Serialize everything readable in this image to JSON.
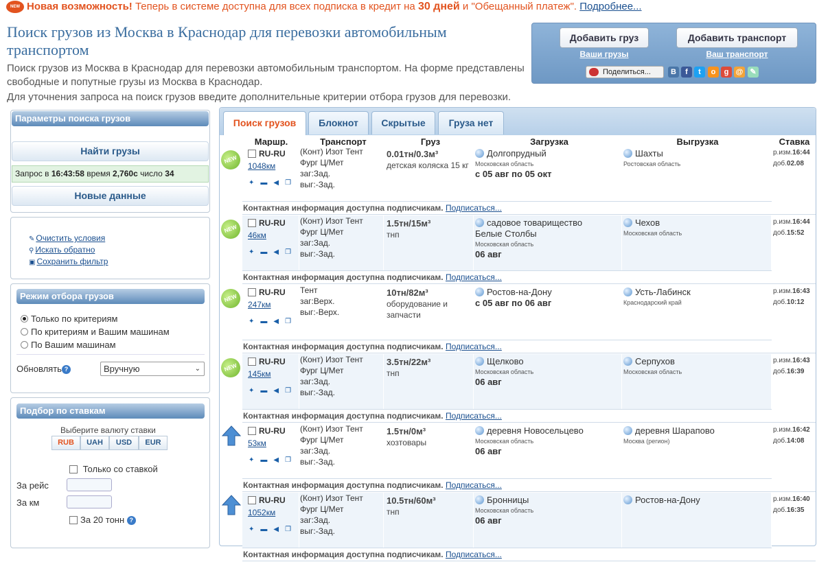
{
  "banner": {
    "badge": "NEW",
    "title": "Новая возможность!",
    "text1": "Теперь в системе доступна для всех подписка в кредит на",
    "days": "30 дней",
    "text2": "и \"Обещанный платеж\".",
    "more": "Подробнее..."
  },
  "page": {
    "title": "Поиск грузов из Москва в Краснодар для перевозки автомобильным транспортом",
    "desc": "Поиск грузов из Москва в Краснодар для перевозки автомобильным транспортом. На форме представлены свободные и попутные грузы из Москва в Краснодар.",
    "desc2": "Для уточнения запроса на поиск грузов введите дополнительные критерии отбора грузов для перевозки."
  },
  "actions": {
    "add_cargo": "Добавить груз",
    "add_transport": "Добавить транспорт",
    "my_cargo": "Ваши грузы",
    "my_transport": "Ваш транспорт",
    "share": "Поделиться..."
  },
  "social": [
    {
      "icon": "vk-icon",
      "t": "B",
      "c": "#4a76a8"
    },
    {
      "icon": "facebook-icon",
      "t": "f",
      "c": "#3b5998"
    },
    {
      "icon": "twitter-icon",
      "t": "t",
      "c": "#1da1f2"
    },
    {
      "icon": "odnoklassniki-icon",
      "t": "o",
      "c": "#f7931e"
    },
    {
      "icon": "googleplus-icon",
      "t": "g",
      "c": "#dd4b39"
    },
    {
      "icon": "mailru-icon",
      "t": "@",
      "c": "#f2a43a"
    },
    {
      "icon": "livejournal-icon",
      "t": "✎",
      "c": "#9db"
    }
  ],
  "sidebar": {
    "params_title": "Параметры поиска грузов",
    "find": "Найти грузы",
    "query": {
      "label": "Запрос в",
      "time": "16:43:58",
      "time_label": "время",
      "duration": "2,760с",
      "count_label": "число",
      "count": "34"
    },
    "new_data": "Новые данные",
    "clear": "Очистить условия",
    "reverse": "Искать обратно",
    "save": "Сохранить фильтр",
    "mode_title": "Режим отбора грузов",
    "modes": [
      "Только по критериям",
      "По критериям и Вашим машинам",
      "По Вашим машинам"
    ],
    "refresh_label": "Обновлять",
    "refresh_value": "Вручную",
    "rates_title": "Подбор по ставкам",
    "currency_label": "Выберите валюту ставки",
    "currencies": [
      "RUB",
      "UAH",
      "USD",
      "EUR"
    ],
    "only_rate": "Только со ставкой",
    "per_trip": "За рейс",
    "per_km": "За км",
    "per_20t": "За 20 тонн"
  },
  "tabs": [
    "Поиск грузов",
    "Блокнот",
    "Скрытые",
    "Груза нет"
  ],
  "columns": {
    "route": "Маршр.",
    "transport": "Транспорт",
    "cargo": "Груз",
    "loading": "Загрузка",
    "unloading": "Выгрузка",
    "rate": "Ставка"
  },
  "contact": {
    "text": "Контактная информация доступна подписчикам.",
    "link": "Подписаться..."
  },
  "rows": [
    {
      "icon": "NEW",
      "route": "RU-RU",
      "km": "1048км",
      "t1": "(Конт) Изот Тент",
      "t2": "Фург Ц/Мет",
      "t3": "заг:Зад.",
      "t4": "выг:-Зад.",
      "w": "0.01тн/0.3м³",
      "goods": "детская коляска 15 кг",
      "from": "Долгопрудный",
      "from2": "",
      "from_reg": "Московская область",
      "date": "с 05 авг по 05 окт",
      "to": "Шахты",
      "to_reg": "Ростовская область",
      "r1": "р.изм.",
      "r1t": "16:44",
      "r2": "доб.",
      "r2t": "02.08"
    },
    {
      "icon": "NEW",
      "route": "RU-RU",
      "km": "46км",
      "t1": "(Конт) Изот Тент",
      "t2": "Фург Ц/Мет",
      "t3": "заг:Зад.",
      "t4": "выг:-Зад.",
      "w": "1.5тн/15м³",
      "goods": "тнп",
      "from": "садовое товарищество",
      "from2": "Белые Столбы",
      "from_reg": "Московская область",
      "date": "06 авг",
      "to": "Чехов",
      "to_reg": "Московская область",
      "r1": "р.изм.",
      "r1t": "16:44",
      "r2": "доб.",
      "r2t": "15:52"
    },
    {
      "icon": "NEW",
      "route": "RU-RU",
      "km": "247км",
      "t1": "Тент",
      "t2": "заг:Верх.",
      "t3": "выг:-Верх.",
      "t4": "",
      "w": "10тн/82м³",
      "goods": "оборудование и запчасти",
      "from": "Ростов-на-Дону",
      "from2": "",
      "from_reg": "",
      "date": "с 05 авг по 06 авг",
      "to": "Усть-Лабинск",
      "to_reg": "Краснодарский край",
      "r1": "р.изм.",
      "r1t": "16:43",
      "r2": "доб.",
      "r2t": "10:12"
    },
    {
      "icon": "NEW",
      "route": "RU-RU",
      "km": "145км",
      "t1": "(Конт) Изот Тент",
      "t2": "Фург Ц/Мет",
      "t3": "заг:Зад.",
      "t4": "выг:-Зад.",
      "w": "3.5тн/22м³",
      "goods": "тнп",
      "from": "Щелково",
      "from2": "",
      "from_reg": "Московская область",
      "date": "06 авг",
      "to": "Серпухов",
      "to_reg": "Московская область",
      "r1": "р.изм.",
      "r1t": "16:43",
      "r2": "доб.",
      "r2t": "16:39"
    },
    {
      "icon": "UP",
      "route": "RU-RU",
      "km": "53км",
      "t1": "(Конт) Изот Тент",
      "t2": "Фург Ц/Мет",
      "t3": "заг:Зад.",
      "t4": "выг:-Зад.",
      "w": "1.5тн/0м³",
      "goods": "хозтовары",
      "from": "деревня Новосельцево",
      "from2": "",
      "from_reg": "Московская область",
      "date": "06 авг",
      "to": "деревня Шарапово",
      "to_reg": "Москва (регион)",
      "r1": "р.изм.",
      "r1t": "16:42",
      "r2": "доб.",
      "r2t": "14:08"
    },
    {
      "icon": "UP",
      "route": "RU-RU",
      "km": "1052км",
      "t1": "(Конт) Изот Тент",
      "t2": "Фург Ц/Мет",
      "t3": "заг:Зад.",
      "t4": "выг:-Зад.",
      "w": "10.5тн/60м³",
      "goods": "тнп",
      "from": "Бронницы",
      "from2": "",
      "from_reg": "Московская область",
      "date": "06 авг",
      "to": "Ростов-на-Дону",
      "to_reg": "",
      "r1": "р.изм.",
      "r1t": "16:40",
      "r2": "доб.",
      "r2t": "16:35"
    }
  ]
}
